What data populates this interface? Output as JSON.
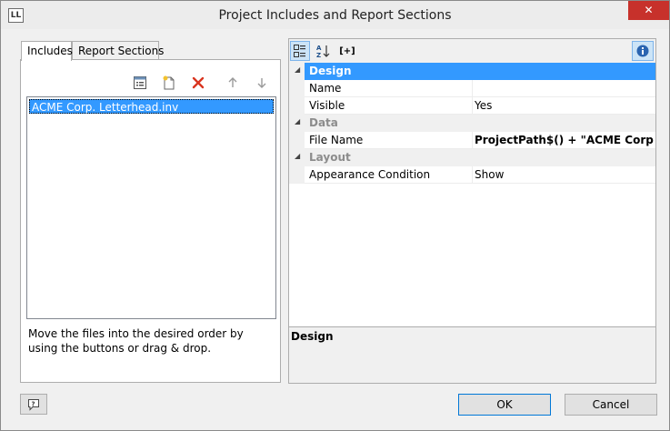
{
  "window": {
    "title": "Project Includes and Report Sections",
    "app_icon_text": "LL",
    "close_label": "✕"
  },
  "tabs": [
    {
      "label": "Includes",
      "active": true
    },
    {
      "label": "Report Sections",
      "active": false
    }
  ],
  "toolbar_left": {
    "icons": [
      "properties-icon",
      "new-file-icon",
      "delete-icon",
      "move-up-icon",
      "move-down-icon"
    ]
  },
  "files": [
    {
      "name": "ACME Corp. Letterhead.inv",
      "selected": true
    }
  ],
  "hint_text": "Move the files into the desired order by using the buttons or drag & drop.",
  "property_toolbar": {
    "categorized_icon": "categorized-icon",
    "sort_icon": "sort-alpha-icon",
    "expand_label": "[+]",
    "info_icon": "info-icon"
  },
  "properties": {
    "categories": [
      {
        "label": "Design",
        "selected": true,
        "rows": [
          {
            "name": "Name",
            "value": ""
          },
          {
            "name": "Visible",
            "value": "Yes"
          }
        ]
      },
      {
        "label": "Data",
        "selected": false,
        "rows": [
          {
            "name": "File Name",
            "value": "ProjectPath$() + \"ACME Corp..."
          }
        ]
      },
      {
        "label": "Layout",
        "selected": false,
        "rows": [
          {
            "name": "Appearance Condition",
            "value": "Show"
          }
        ]
      }
    ]
  },
  "description": {
    "title": "Design"
  },
  "buttons": {
    "ok": "OK",
    "cancel": "Cancel"
  },
  "colors": {
    "selection": "#3399ff",
    "close": "#c7312b",
    "delete_icon": "#d9351f"
  }
}
